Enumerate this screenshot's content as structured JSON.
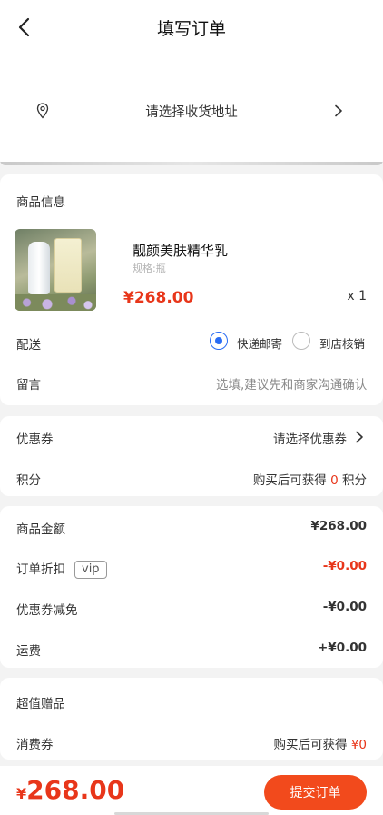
{
  "header": {
    "title": "填写订单"
  },
  "address": {
    "placeholder": "请选择收货地址"
  },
  "product_card": {
    "section_title": "商品信息",
    "product": {
      "name": "靓颜美肤精华乳",
      "spec": "规格:瓶",
      "price": "¥268.00",
      "qty": "x 1"
    },
    "delivery": {
      "label": "配送",
      "options": [
        {
          "label": "快递邮寄",
          "selected": true
        },
        {
          "label": "到店核销",
          "selected": false
        }
      ]
    },
    "message": {
      "label": "留言",
      "placeholder": "选填,建议先和商家沟通确认"
    }
  },
  "coupon_card": {
    "coupon": {
      "label": "优惠券",
      "value": "请选择优惠券"
    },
    "points": {
      "label": "积分",
      "prefix": "购买后可获得",
      "amount": "0",
      "suffix": "积分"
    }
  },
  "amount_card": {
    "goods_amount": {
      "label": "商品金额",
      "value": "¥268.00"
    },
    "discount": {
      "label": "订单折扣",
      "tag": "vip",
      "value": "-¥0.00"
    },
    "coupon_deduct": {
      "label": "优惠券减免",
      "value": "-¥0.00"
    },
    "shipping": {
      "label": "运费",
      "value": "+¥0.00"
    }
  },
  "gift_card": {
    "title": "超值赠品",
    "voucher": {
      "label": "消费券",
      "prefix": "购买后可获得",
      "value": "¥0"
    }
  },
  "bottom_bar": {
    "currency": "¥",
    "total": "268.00",
    "submit_label": "提交订单"
  },
  "colors": {
    "accent": "#e8361a",
    "button": "#f24a1c",
    "radio": "#2a6df4"
  }
}
